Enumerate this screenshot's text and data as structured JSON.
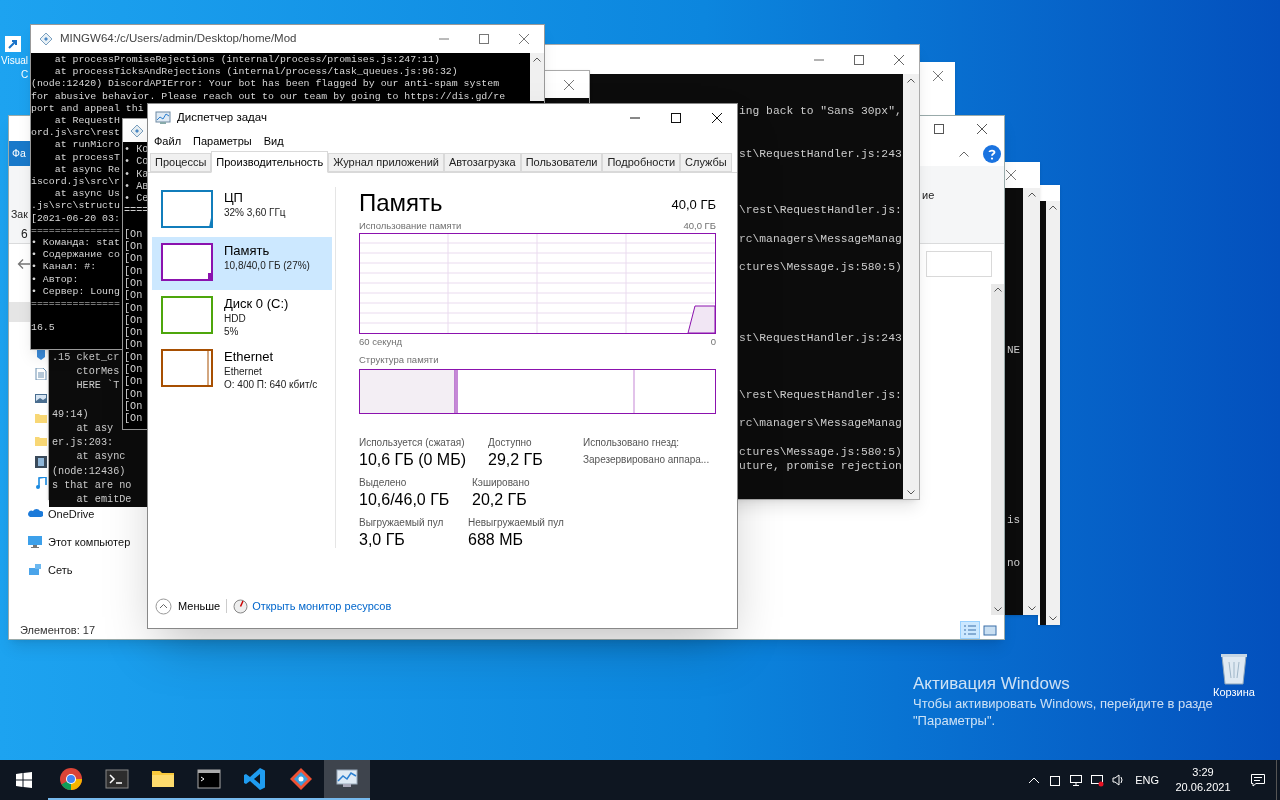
{
  "shortcut_icon": {
    "label_lines": [
      "Visual",
      "C"
    ]
  },
  "recycle_bin": {
    "label": "Корзина"
  },
  "activation_notice": {
    "title": "Активация Windows",
    "lines": [
      "Чтобы активировать Windows, перейдите в разде",
      "\"Параметры\"."
    ]
  },
  "explorer": {
    "ribbon_tab": "Фа",
    "fragments": [
      "Зак",
      "6"
    ],
    "ribbon_fragment": "ие",
    "nav_items": [
      {
        "label": "OneDrive",
        "kind": "cloud"
      },
      {
        "label": "Этот компьютер",
        "kind": "computer"
      },
      {
        "label": "Сеть",
        "kind": "network"
      }
    ],
    "status": "Элементов: 17",
    "views": [
      {
        "kind": "details",
        "selected": true
      },
      {
        "kind": "tiles",
        "selected": false
      }
    ]
  },
  "terminal_right": {
    "lines": [
      "ing back to \"Sans 30px\",",
      "st\\RequestHandler.js:243",
      "\\rest\\RequestHandler.js:",
      "rc\\managers\\MessageManag",
      "ctures\\Message.js:580:5)",
      "st\\RequestHandler.js:243",
      "\\rest\\RequestHandler.js:",
      "rc\\managers\\MessageManag",
      "ctures\\Message.js:580:5)",
      "uture, promise rejection"
    ]
  },
  "terminal_back": {
    "lines": [
      ".15 cket_cr",
      "    ctorMes",
      "    HERE `T",
      "49:14)",
      "    at asy",
      "er.js:203:",
      "    at async",
      "(node:12436)",
      "s that are no",
      "    at emitDe"
    ]
  },
  "terminal_mingw": {
    "title": "MINGW64:/c/Users/admin/Desktop/home/Mod",
    "lines": [
      "    at processPromiseRejections (internal/process/promises.js:247:11)",
      "    at processTicksAndRejections (internal/process/task_queues.js:96:32)",
      "(node:12420) DiscordAPIError: Your bot has been flagged by our anti-spam system",
      "for abusive behavior. Please reach out to our team by going to https://dis.gd/re",
      "port and appeal thi",
      "    at RequestH",
      "ord.js\\src\\rest",
      "    at runMicro",
      "    at processT",
      "    at async Re",
      "iscord.js\\src\\r",
      "    at async Us",
      ".js\\src\\structu",
      "[2021-06-20 03:",
      "===============",
      "• Команда: stat",
      "• Содержание co",
      "• Канал: #:",
      "• Автор:",
      "• Сервер: Loung",
      "==============="
    ],
    "prompt": "16.5"
  },
  "terminal_log": {
    "bullets": [
      "• Ко",
      "• Со",
      "• Ка",
      "• Ав",
      "• Се",
      "===="
    ],
    "log_lines": [
      "[On",
      "[On",
      "[On",
      "[On",
      "[On",
      "[On",
      "[On",
      "[On",
      "[On",
      "[On",
      "[On",
      "[On",
      "[On",
      "[On",
      "[On",
      "[On"
    ]
  },
  "terminal_far": {
    "fragments": [
      "NE",
      "is",
      "no"
    ]
  },
  "task_manager": {
    "title": "Диспетчер задач",
    "menu": [
      "Файл",
      "Параметры",
      "Вид"
    ],
    "tabs": [
      {
        "label": "Процессы",
        "selected": false
      },
      {
        "label": "Производительность",
        "selected": true
      },
      {
        "label": "Журнал приложений",
        "selected": false
      },
      {
        "label": "Автозагрузка",
        "selected": false
      },
      {
        "label": "Пользователи",
        "selected": false
      },
      {
        "label": "Подробности",
        "selected": false
      },
      {
        "label": "Службы",
        "selected": false
      }
    ],
    "resources": [
      {
        "kind": "cpu",
        "name": "ЦП",
        "lines": [
          "32%  3,60 ГГц"
        ],
        "color": "#117dbb",
        "selected": false
      },
      {
        "kind": "memory",
        "name": "Память",
        "lines": [
          "10,8/40,0 ГБ (27%)"
        ],
        "color": "#8b12ae",
        "selected": true
      },
      {
        "kind": "disk",
        "name": "Диск 0 (C:)",
        "lines": [
          "HDD",
          "5%"
        ],
        "color": "#4da60c",
        "selected": false
      },
      {
        "kind": "network",
        "name": "Ethernet",
        "lines": [
          "Ethernet",
          "О: 400 П: 640 кбит/с"
        ],
        "color": "#a74f01",
        "selected": false
      }
    ],
    "detail": {
      "title": "Память",
      "total": "40,0 ГБ",
      "usage_label": "Использование памяти",
      "usage_max": "40,0 ГБ",
      "time_span": "60 секунд",
      "usage_min": "0",
      "composition_label": "Структура памяти",
      "stats": [
        [
          {
            "label": "Используется (сжатая)",
            "value": "10,6 ГБ (0 МБ)"
          },
          {
            "label": "Доступно",
            "value": "29,2 ГБ"
          }
        ],
        [
          {
            "label": "Выделено",
            "value": "10,6/46,0 ГБ"
          },
          {
            "label": "Кэшировано",
            "value": "20,2 ГБ"
          }
        ],
        [
          {
            "label": "Выгружаемый пул",
            "value": "3,0 ГБ"
          },
          {
            "label": "Невыгружаемый пул",
            "value": "688 МБ"
          }
        ]
      ],
      "side_stats": [
        {
          "label": "Использовано гнезд:",
          "value": "Зарезервировано аппара..."
        }
      ]
    },
    "footer": {
      "less": "Меньше",
      "link": "Открыть монитор ресурсов"
    }
  },
  "taskbar": {
    "apps": [
      {
        "kind": "chrome",
        "selected": false
      },
      {
        "kind": "terminal",
        "selected": false
      },
      {
        "kind": "folder",
        "selected": false
      },
      {
        "kind": "cmd",
        "selected": false
      },
      {
        "kind": "vscode",
        "selected": false
      },
      {
        "kind": "git",
        "selected": false
      },
      {
        "kind": "taskmgr",
        "selected": true
      }
    ],
    "language": "ENG",
    "time": "3:29",
    "date": "20.06.2021"
  }
}
